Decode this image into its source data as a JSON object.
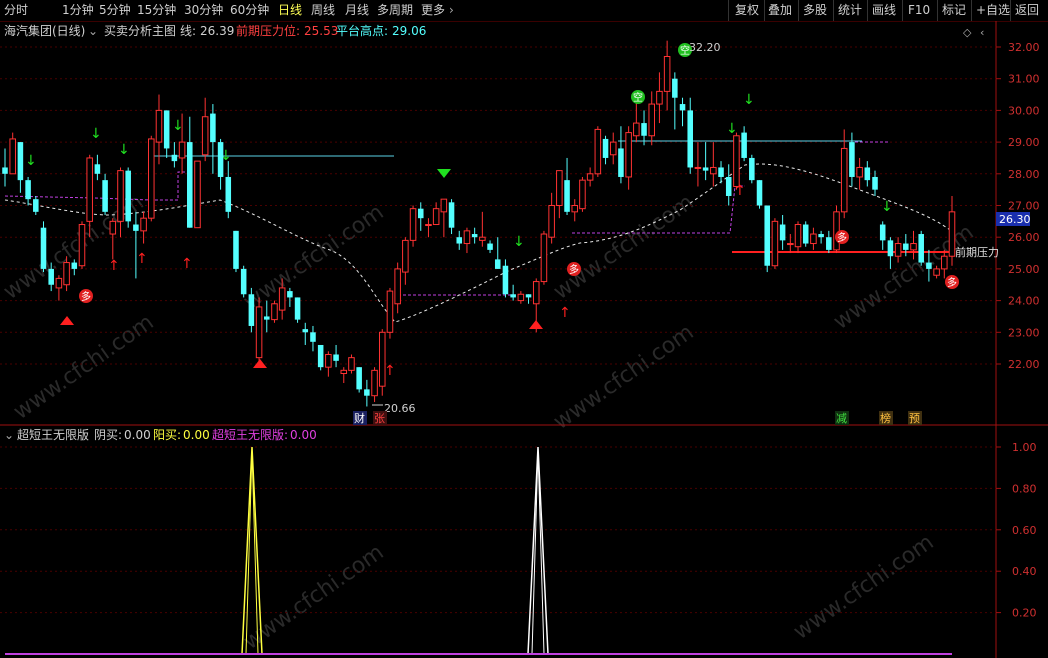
{
  "toolbar": {
    "periods": [
      "分时",
      "1分钟",
      "5分钟",
      "15分钟",
      "30分钟",
      "60分钟",
      "日线",
      "周线",
      "月线",
      "多周期",
      "更多"
    ],
    "active_period": "日线",
    "right_buttons": [
      "复权",
      "叠加",
      "多股",
      "统计",
      "画线",
      "F10",
      "标记",
      "+自选",
      "返回"
    ]
  },
  "infobar": {
    "stock": "海汽集团(日线)",
    "indicator": "买卖分析主图",
    "line_label": "线:",
    "line_value": "26.39",
    "pressure_label": "前期压力位:",
    "pressure_value": "25.53",
    "platform_label": "平台高点:",
    "platform_value": "29.06"
  },
  "subinfo": {
    "indicator": "超短王无限版",
    "yin_label": "阴买:",
    "yin_value": "0.00",
    "yang_label": "阳买:",
    "yang_value": "0.00",
    "main_label": "超短王无限版:",
    "main_value": "0.00"
  },
  "price_axis": [
    "32.00",
    "31.00",
    "30.00",
    "29.00",
    "28.00",
    "27.00",
    "26.00",
    "25.00",
    "24.00",
    "23.00",
    "22.00"
  ],
  "current_price": "26.30",
  "high_label": "32.20",
  "low_label": "20.66",
  "pressure_text": "前期压力",
  "sub_axis": [
    "1.00",
    "0.80",
    "0.60",
    "0.40",
    "0.20"
  ],
  "badges": {
    "cai": "财",
    "zhang": "张",
    "jian": "减",
    "bang": "榜",
    "yu": "预"
  },
  "signals": {
    "duo": "多",
    "kong": "空"
  },
  "watermark": "www.cfchi.com",
  "colors": {
    "up": "#ff3232",
    "down": "#54ffff",
    "grid": "#5a0000",
    "ma": "#ffffff",
    "platform": "#5ad2e6",
    "dash": "#c040e0",
    "pressure": "#ff2020"
  },
  "chart_data": {
    "type": "candlestick",
    "candles": [
      [
        28.2,
        28.8,
        27.6,
        28.0
      ],
      [
        28.0,
        29.3,
        28.0,
        29.1
      ],
      [
        29.0,
        29.0,
        27.4,
        27.8
      ],
      [
        27.8,
        27.9,
        27.0,
        27.2
      ],
      [
        27.2,
        27.3,
        26.7,
        26.8
      ],
      [
        26.3,
        26.5,
        24.9,
        25.0
      ],
      [
        25.0,
        25.2,
        24.3,
        24.5
      ],
      [
        24.4,
        24.8,
        24.0,
        24.7
      ],
      [
        24.5,
        25.4,
        24.3,
        25.2
      ],
      [
        25.2,
        25.3,
        24.8,
        25.0
      ],
      [
        25.1,
        26.5,
        25.0,
        26.4
      ],
      [
        26.5,
        28.6,
        26.0,
        28.5
      ],
      [
        28.3,
        28.6,
        27.8,
        28.0
      ],
      [
        27.8,
        28.0,
        26.7,
        26.8
      ],
      [
        26.1,
        26.6,
        25.3,
        26.5
      ],
      [
        26.5,
        28.2,
        26.0,
        28.1
      ],
      [
        28.1,
        28.2,
        26.3,
        26.5
      ],
      [
        26.4,
        26.8,
        24.7,
        26.2
      ],
      [
        26.2,
        26.8,
        25.8,
        26.6
      ],
      [
        26.6,
        29.2,
        26.5,
        29.1
      ],
      [
        29.0,
        30.5,
        28.3,
        30.0
      ],
      [
        30.0,
        30.0,
        28.5,
        28.8
      ],
      [
        28.6,
        29.0,
        28.2,
        28.4
      ],
      [
        28.5,
        29.9,
        28.0,
        29.0
      ],
      [
        29.0,
        29.8,
        26.3,
        26.3
      ],
      [
        26.3,
        26.5,
        27.0,
        28.4
      ],
      [
        28.6,
        30.4,
        28.4,
        29.8
      ],
      [
        29.9,
        30.2,
        28.0,
        29.0
      ],
      [
        29.0,
        29.1,
        27.5,
        27.9
      ],
      [
        27.9,
        28.4,
        26.6,
        26.8
      ],
      [
        26.2,
        26.2,
        24.9,
        25.0
      ],
      [
        25.0,
        25.1,
        24.1,
        24.2
      ],
      [
        24.2,
        24.4,
        23.0,
        23.2
      ],
      [
        22.2,
        24.1,
        22.0,
        23.8
      ],
      [
        23.5,
        24.0,
        23.0,
        23.4
      ],
      [
        23.4,
        24.0,
        23.3,
        23.9
      ],
      [
        23.7,
        24.7,
        23.4,
        24.4
      ],
      [
        24.3,
        24.4,
        23.8,
        24.1
      ],
      [
        24.1,
        24.1,
        23.3,
        23.4
      ],
      [
        23.1,
        23.3,
        22.6,
        23.0
      ],
      [
        23.0,
        23.2,
        22.4,
        22.7
      ],
      [
        22.6,
        22.6,
        21.8,
        21.9
      ],
      [
        21.9,
        22.4,
        21.6,
        22.3
      ],
      [
        22.3,
        22.6,
        21.9,
        22.1
      ],
      [
        21.7,
        21.9,
        21.4,
        21.8
      ],
      [
        21.8,
        22.3,
        21.7,
        22.2
      ],
      [
        21.9,
        21.9,
        21.1,
        21.2
      ],
      [
        21.2,
        21.5,
        20.66,
        21.0
      ],
      [
        21.0,
        21.9,
        20.8,
        21.8
      ],
      [
        21.3,
        23.1,
        21.0,
        23.0
      ],
      [
        23.0,
        24.4,
        22.8,
        24.3
      ],
      [
        23.9,
        25.2,
        23.6,
        25.0
      ],
      [
        24.9,
        26.0,
        24.5,
        25.9
      ],
      [
        25.9,
        27.0,
        25.7,
        26.9
      ],
      [
        26.9,
        27.1,
        26.2,
        26.6
      ],
      [
        26.4,
        26.6,
        26.0,
        26.4
      ],
      [
        26.4,
        27.1,
        26.4,
        26.9
      ],
      [
        26.8,
        27.2,
        26.0,
        27.2
      ],
      [
        27.1,
        27.2,
        26.1,
        26.3
      ],
      [
        26.0,
        26.2,
        25.6,
        25.8
      ],
      [
        25.8,
        26.3,
        25.5,
        26.2
      ],
      [
        26.1,
        26.3,
        25.8,
        26.0
      ],
      [
        25.9,
        26.8,
        25.7,
        26.0
      ],
      [
        25.8,
        25.9,
        25.5,
        25.6
      ],
      [
        25.3,
        26.0,
        25.0,
        25.0
      ],
      [
        25.1,
        25.3,
        24.1,
        24.2
      ],
      [
        24.2,
        24.5,
        24.0,
        24.1
      ],
      [
        24.0,
        24.3,
        23.9,
        24.2
      ],
      [
        24.2,
        24.2,
        23.9,
        24.1
      ],
      [
        23.9,
        24.7,
        23.0,
        24.6
      ],
      [
        24.6,
        26.2,
        24.5,
        26.1
      ],
      [
        26.0,
        27.4,
        25.8,
        27.0
      ],
      [
        27.0,
        28.1,
        26.6,
        28.1
      ],
      [
        27.8,
        28.5,
        26.7,
        26.8
      ],
      [
        26.8,
        27.2,
        26.5,
        27.0
      ],
      [
        26.9,
        27.9,
        26.8,
        27.8
      ],
      [
        27.8,
        28.2,
        27.6,
        28.0
      ],
      [
        28.0,
        29.5,
        27.9,
        29.4
      ],
      [
        29.1,
        29.2,
        28.3,
        28.5
      ],
      [
        28.6,
        29.3,
        28.3,
        29.0
      ],
      [
        28.8,
        29.5,
        27.7,
        27.9
      ],
      [
        27.9,
        29.5,
        27.5,
        29.3
      ],
      [
        29.2,
        30.3,
        29.0,
        29.6
      ],
      [
        29.6,
        30.0,
        28.9,
        29.2
      ],
      [
        29.2,
        30.6,
        28.9,
        30.2
      ],
      [
        30.2,
        31.2,
        29.6,
        30.6
      ],
      [
        30.6,
        32.2,
        30.0,
        31.7
      ],
      [
        31.0,
        31.2,
        29.4,
        30.4
      ],
      [
        30.2,
        30.4,
        29.5,
        30.0
      ],
      [
        30.0,
        30.4,
        28.0,
        28.2
      ],
      [
        28.2,
        29.0,
        27.6,
        28.2
      ],
      [
        28.2,
        29.0,
        27.8,
        28.1
      ],
      [
        28.0,
        29.0,
        27.6,
        28.2
      ],
      [
        28.2,
        28.4,
        27.7,
        27.9
      ],
      [
        27.9,
        28.3,
        27.0,
        27.3
      ],
      [
        27.6,
        29.3,
        27.5,
        29.2
      ],
      [
        29.3,
        29.5,
        28.4,
        28.5
      ],
      [
        28.5,
        28.6,
        27.7,
        27.8
      ],
      [
        27.8,
        27.8,
        26.9,
        27.0
      ],
      [
        27.0,
        27.0,
        24.9,
        25.1
      ],
      [
        25.1,
        26.6,
        25.0,
        26.5
      ],
      [
        26.4,
        26.7,
        25.6,
        25.9
      ],
      [
        25.8,
        26.1,
        25.5,
        25.8
      ],
      [
        25.7,
        26.5,
        25.5,
        26.4
      ],
      [
        26.4,
        26.5,
        25.7,
        25.8
      ],
      [
        25.8,
        26.3,
        25.6,
        26.1
      ],
      [
        26.1,
        26.2,
        25.8,
        26.0
      ],
      [
        26.0,
        26.2,
        25.5,
        25.6
      ],
      [
        25.6,
        27.0,
        25.5,
        26.8
      ],
      [
        26.8,
        29.4,
        26.6,
        28.8
      ],
      [
        29.0,
        29.3,
        27.6,
        27.9
      ],
      [
        27.9,
        28.5,
        27.5,
        28.2
      ],
      [
        28.2,
        28.4,
        27.6,
        27.8
      ],
      [
        27.9,
        28.1,
        27.3,
        27.5
      ],
      [
        26.4,
        26.5,
        25.6,
        25.9
      ],
      [
        25.9,
        26.0,
        25.0,
        25.4
      ],
      [
        25.4,
        26.0,
        25.2,
        25.8
      ],
      [
        25.8,
        26.1,
        25.4,
        25.6
      ],
      [
        25.6,
        26.2,
        25.3,
        25.8
      ],
      [
        26.1,
        26.2,
        25.1,
        25.2
      ],
      [
        25.2,
        25.6,
        24.6,
        25.0
      ],
      [
        24.8,
        25.1,
        24.7,
        25.0
      ],
      [
        25.0,
        25.6,
        24.7,
        25.4
      ],
      [
        25.4,
        27.3,
        25.1,
        26.8
      ]
    ],
    "ylim": [
      20.5,
      32.6
    ],
    "spikes": [
      {
        "x": 252,
        "color": "#ffff40"
      },
      {
        "x": 538,
        "color": "#ffffff"
      }
    ],
    "sub_ylim": [
      0,
      1.05
    ]
  }
}
